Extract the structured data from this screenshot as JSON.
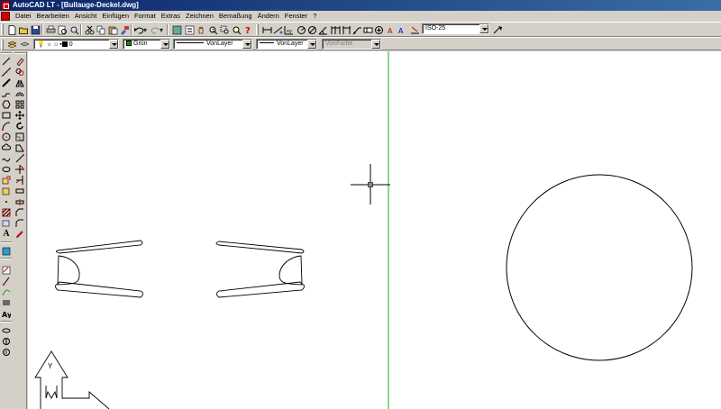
{
  "window": {
    "title": "AutoCAD LT - [Bullauge-Deckel.dwg]"
  },
  "menu": [
    "Datei",
    "Bearbeiten",
    "Ansicht",
    "Einfügen",
    "Format",
    "Extras",
    "Zeichnen",
    "Bemaßung",
    "Ändern",
    "Fenster",
    "?"
  ],
  "toolbar": {
    "dimstyle_value": "ISO-25"
  },
  "properties": {
    "layer_value": "0",
    "color_value": "Grün",
    "color_hex": "#00a000",
    "linetype_value": "VonLayer",
    "lineweight_value": "VonLayer",
    "plotstyle_value": "VonFarbe"
  },
  "colors": {
    "viewport_divider": "#3fbf3f",
    "title_bar": "#0a246a",
    "chrome": "#d4d0c8"
  },
  "ucs": {
    "y_label": "Y",
    "w_label": "W"
  }
}
